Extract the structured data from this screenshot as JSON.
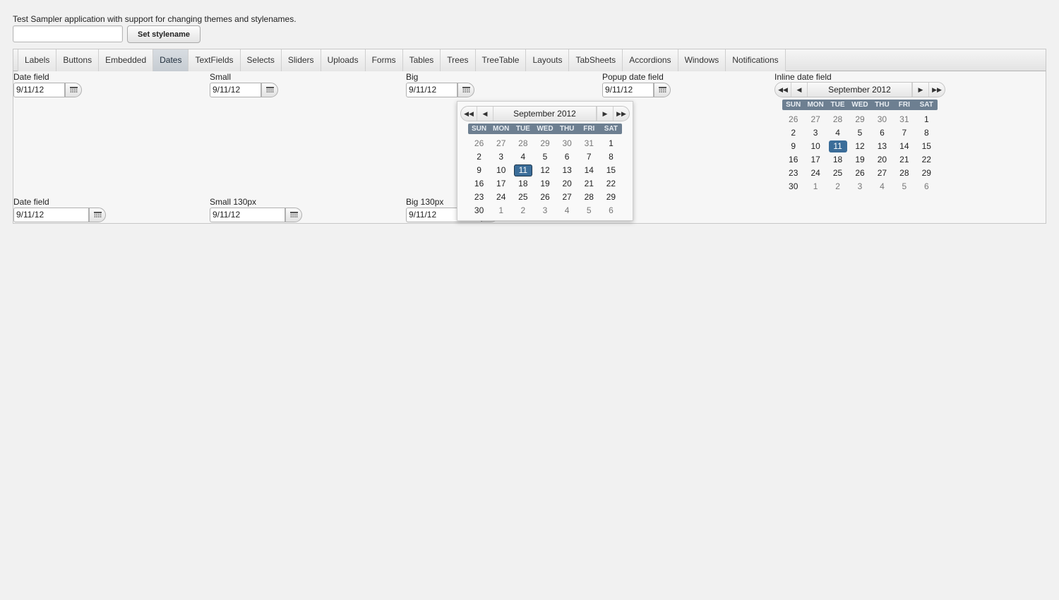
{
  "intro": "Test Sampler application with support for changing themes and stylenames.",
  "stylename_input": {
    "value": "",
    "placeholder": ""
  },
  "set_stylename_label": "Set stylename",
  "tabs": [
    "Labels",
    "Buttons",
    "Embedded",
    "Dates",
    "TextFields",
    "Selects",
    "Sliders",
    "Uploads",
    "Forms",
    "Tables",
    "Trees",
    "TreeTable",
    "Layouts",
    "TabSheets",
    "Accordions",
    "Windows",
    "Notifications"
  ],
  "selected_tab": "Dates",
  "fields": {
    "date_field": {
      "caption": "Date field",
      "value": "9/11/12"
    },
    "small": {
      "caption": "Small",
      "value": "9/11/12"
    },
    "big": {
      "caption": "Big",
      "value": "9/11/12"
    },
    "popup": {
      "caption": "Popup date field",
      "value": "9/11/12"
    },
    "inline": {
      "caption": "Inline date field"
    },
    "date_field_2": {
      "caption": "Date field",
      "value": "9/11/12"
    },
    "small_130": {
      "caption": "Small 130px",
      "value": "9/11/12"
    },
    "big_130": {
      "caption": "Big 130px",
      "value": "9/11/12"
    }
  },
  "calendar": {
    "month_label": "September 2012",
    "weekdays": [
      "SUN",
      "MON",
      "TUE",
      "WED",
      "THU",
      "FRI",
      "SAT"
    ],
    "weeks": [
      [
        "26",
        "27",
        "28",
        "29",
        "30",
        "31",
        "1"
      ],
      [
        "2",
        "3",
        "4",
        "5",
        "6",
        "7",
        "8"
      ],
      [
        "9",
        "10",
        "11",
        "12",
        "13",
        "14",
        "15"
      ],
      [
        "16",
        "17",
        "18",
        "19",
        "20",
        "21",
        "22"
      ],
      [
        "23",
        "24",
        "25",
        "26",
        "27",
        "28",
        "29"
      ],
      [
        "30",
        "1",
        "2",
        "3",
        "4",
        "5",
        "6"
      ]
    ],
    "selected_day": "11",
    "accent": "#3b6d99",
    "header_color": "#6d7f91"
  }
}
